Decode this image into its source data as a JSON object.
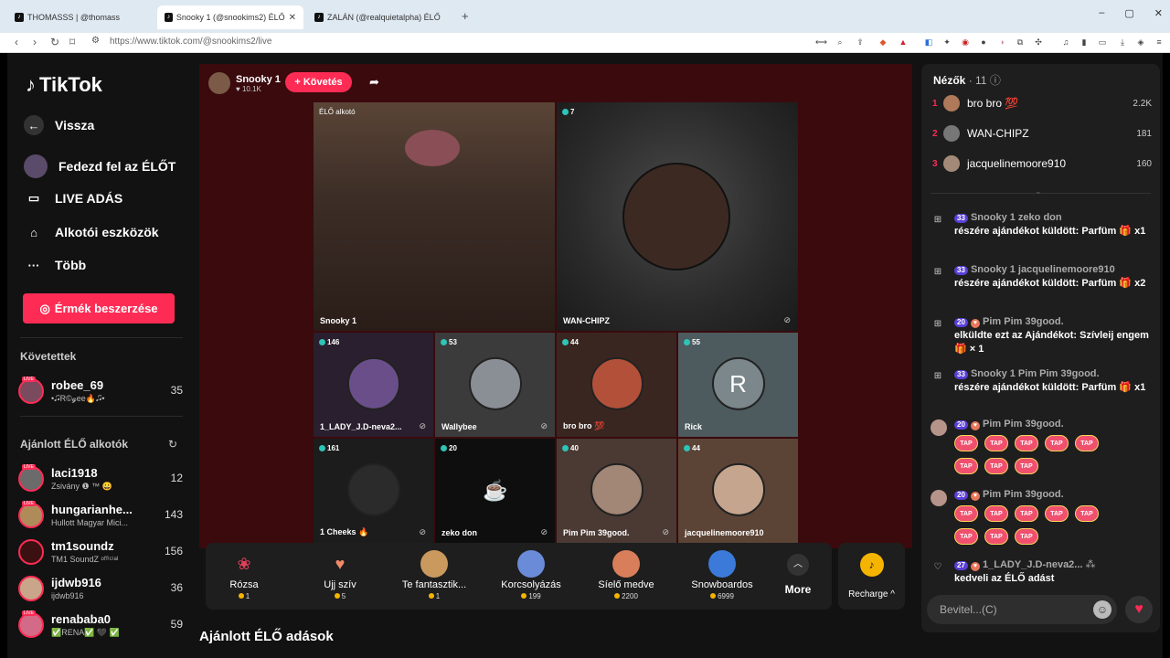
{
  "browser": {
    "tabs": [
      {
        "title": "THOMASSS | @thomass",
        "active": false
      },
      {
        "title": "Snooky 1 (@snookims2) ÉLŐ",
        "active": true
      },
      {
        "title": "ZALÁN (@realquietalpha) ÉLŐ",
        "active": false
      }
    ],
    "new_tab": "+",
    "url": "https://www.tiktok.com/@snookims2/live"
  },
  "sidebar": {
    "logo": "TikTok",
    "back": "Vissza",
    "menu": [
      {
        "label": "Fedezd fel az ÉLŐT",
        "icon": "avatar-icon"
      },
      {
        "label": "LIVE ADÁS",
        "icon": "camera-icon"
      },
      {
        "label": "Alkotói eszközök",
        "icon": "creator-tools-icon"
      },
      {
        "label": "Több",
        "icon": "more-icon"
      }
    ],
    "coins_button": "Érmék beszerzése",
    "following_title": "Követettek",
    "following": [
      {
        "name": "robee_69",
        "sub": "•🎜R©ℊee🔥🎜•",
        "count": "35"
      }
    ],
    "recommended_title": "Ajánlott ÉLŐ alkotók",
    "recommended": [
      {
        "name": "laci1918",
        "sub": "Zsivány ❶ ™ 😀",
        "count": "12"
      },
      {
        "name": "hungarianhe...",
        "sub": "Hullott Magyar Mici...",
        "count": "143"
      },
      {
        "name": "tm1soundz",
        "sub": "TM1 SoundZ ᵒᶠᶠⁱᶜⁱᵃˡ",
        "count": "156"
      },
      {
        "name": "ijdwb916",
        "sub": "ijdwb916",
        "count": "36"
      },
      {
        "name": "renababa0",
        "sub": "✅RENA✅ 🖤 ✅",
        "count": "59"
      }
    ]
  },
  "stream": {
    "host_name": "Snooky 1",
    "host_likes": "♥ 10.1K",
    "follow_button": "+ Követés",
    "main_tile": {
      "creator_tag": "ÉLŐ alkotó",
      "name": "Snooky 1"
    },
    "guest_tile": {
      "badge": "7",
      "name": "WAN-CHIPZ"
    },
    "guests": [
      {
        "badge": "146",
        "name": "1_LADY_J.D-neva2..."
      },
      {
        "badge": "53",
        "name": "Wallybee"
      },
      {
        "badge": "44",
        "name": "bro bro 💯"
      },
      {
        "badge": "55",
        "name": "Rick",
        "initial": "R"
      },
      {
        "badge": "161",
        "name": "1 Cheeks 🔥"
      },
      {
        "badge": "20",
        "name": "zeko don"
      },
      {
        "badge": "40",
        "name": "Pim Pim 39good."
      },
      {
        "badge": "44",
        "name": "jacquelinemoore910"
      }
    ]
  },
  "gifts": [
    {
      "name": "Rózsa",
      "price": "1",
      "icon": "rose-icon"
    },
    {
      "name": "Ujj szív",
      "price": "5",
      "icon": "finger-heart-icon"
    },
    {
      "name": "Te fantasztik...",
      "price": "1",
      "icon": "hamster-icon"
    },
    {
      "name": "Korcsolyázás",
      "price": "199",
      "icon": "skates-icon"
    },
    {
      "name": "Síelő medve",
      "price": "2200",
      "icon": "ski-bear-icon"
    },
    {
      "name": "Snowboardos",
      "price": "6999",
      "icon": "snowboarder-icon"
    }
  ],
  "more_label": "More",
  "recharge_label": "Recharge ^",
  "bottom_title": "Ajánlott ÉLŐ adások",
  "chat": {
    "viewers_title": "Nézők",
    "viewers_count": "· 11",
    "ranking": [
      {
        "rank": "1",
        "name": "bro bro 💯",
        "score": "2.2K"
      },
      {
        "rank": "2",
        "name": "WAN-CHIPZ",
        "score": "181"
      },
      {
        "rank": "3",
        "name": "jacquelinemoore910",
        "score": "160"
      }
    ],
    "messages": [
      {
        "level": "33",
        "name": "Snooky 1 zeko don",
        "text": "részére ajándékot küldött: Parfüm 🎁 x1"
      },
      {
        "level": "33",
        "name": "Snooky 1 jacquelinemoore910",
        "text": "részére ajándékot küldött: Parfüm 🎁 x2"
      },
      {
        "level": "20",
        "name": "Pim Pim 39good.",
        "text": "elküldte ezt az Ajándékot: Szívleij engem 🎁 × 1"
      },
      {
        "level": "33",
        "name": "Snooky 1 Pim Pim 39good.",
        "text": "részére ajándékot küldött: Parfüm 🎁 x1"
      },
      {
        "level": "20",
        "name": "Pim Pim 39good."
      },
      {
        "level": "20",
        "name": "Pim Pim 39good."
      },
      {
        "level": "27",
        "name": "1_LADY_J.D-neva2...",
        "text": "kedveli az ÉLŐ adást"
      }
    ],
    "tap_label": "TAP",
    "input_placeholder": "Bevitel...(C)"
  }
}
